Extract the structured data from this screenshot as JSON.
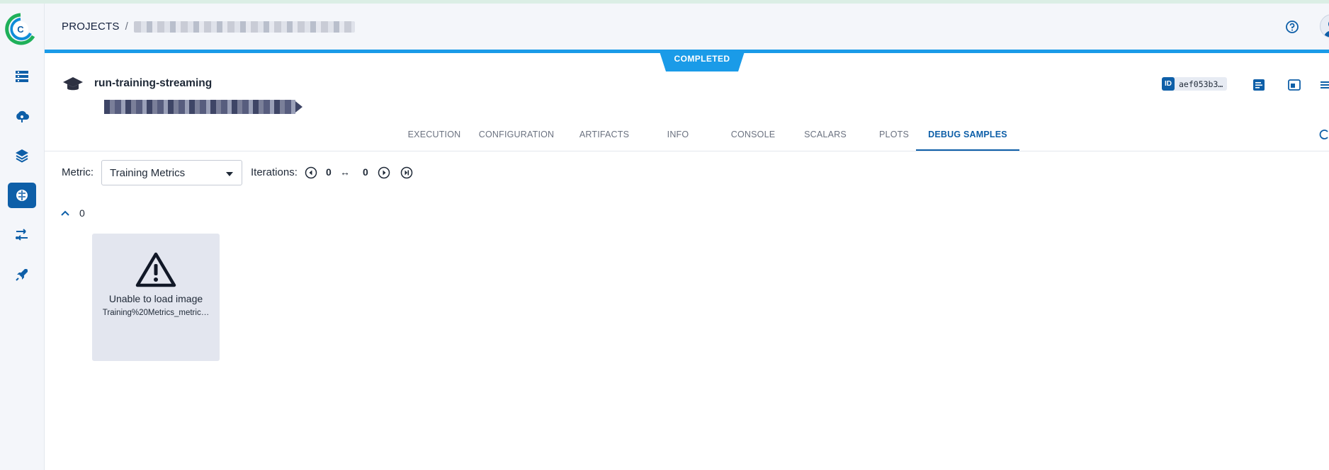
{
  "header": {
    "breadcrumb_root": "PROJECTS",
    "breadcrumb_separator": "/"
  },
  "status": {
    "label": "COMPLETED",
    "color": "#1a9be8"
  },
  "task": {
    "name": "run-training-streaming",
    "id_tag": "ID",
    "id_value": "aef053b3…"
  },
  "tabs": [
    {
      "label": "EXECUTION"
    },
    {
      "label": "CONFIGURATION"
    },
    {
      "label": "ARTIFACTS"
    },
    {
      "label": "INFO"
    },
    {
      "label": "CONSOLE"
    },
    {
      "label": "SCALARS"
    },
    {
      "label": "PLOTS"
    },
    {
      "label": "DEBUG SAMPLES",
      "active": true
    }
  ],
  "toolbar": {
    "metric_label": "Metric:",
    "metric_value": "Training Metrics",
    "iterations_label": "Iterations:",
    "iteration_start": "0",
    "iteration_swap": "↔",
    "iteration_end": "0"
  },
  "group": {
    "label": "0"
  },
  "sample": {
    "error_title": "Unable to load image",
    "file_name": "Training%20Metrics_metric…"
  },
  "colors": {
    "accent": "#0e5fa8",
    "sidebar_bg": "#f4f6fa",
    "card_bg": "#e3e6ef"
  },
  "icons": {
    "sidebar": [
      "dashboard-icon",
      "cloud-icon",
      "layers-icon",
      "brain-icon",
      "pipeline-icon",
      "rocket-icon"
    ]
  }
}
